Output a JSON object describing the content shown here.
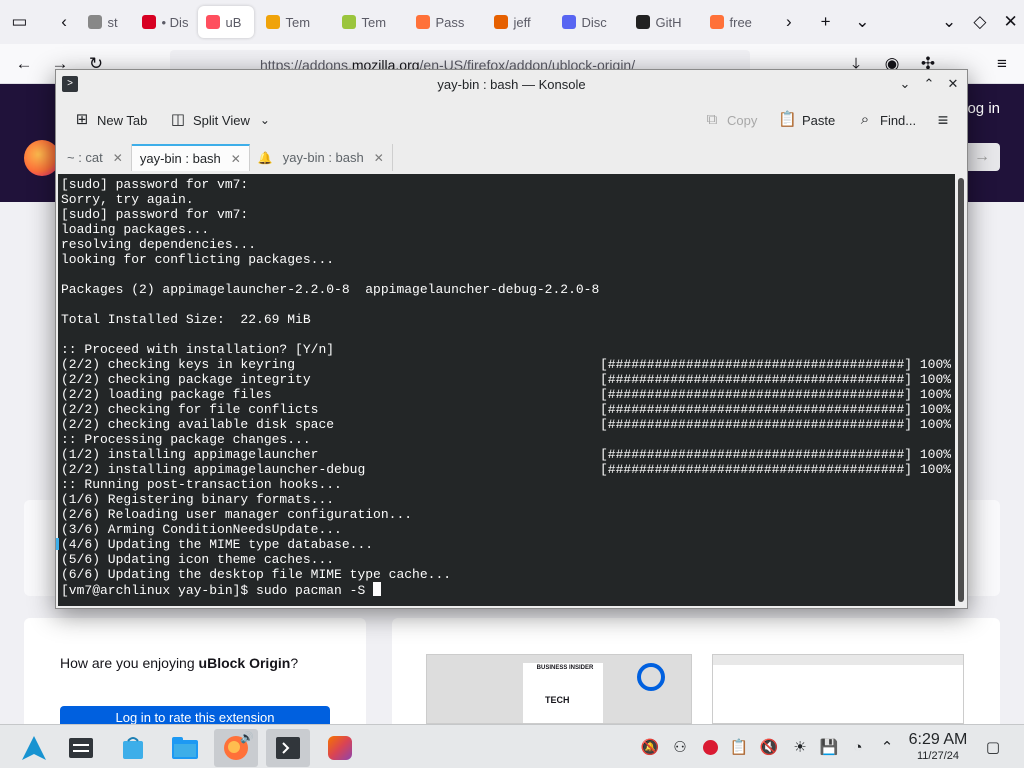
{
  "firefox": {
    "tabs": [
      {
        "label": "st",
        "color": "#888888"
      },
      {
        "label": "• Dis",
        "color": "#d70022"
      },
      {
        "label": "uB",
        "color": "#ff4f5e",
        "active": true
      },
      {
        "label": "Tem",
        "color": "#f0a30a"
      },
      {
        "label": "Tem",
        "color": "#9bc53d"
      },
      {
        "label": "Pass",
        "color": "#ff7139"
      },
      {
        "label": "jeff",
        "color": "#e66000"
      },
      {
        "label": "Disc",
        "color": "#5865f2"
      },
      {
        "label": "GitH",
        "color": "#222222"
      },
      {
        "label": "free",
        "color": "#ff7139"
      }
    ],
    "url_prefix": "https://addons.",
    "url_domain": "mozilla.org",
    "url_rest": "/en-US/firefox/addon/ublock-origin/",
    "login": "og in",
    "rate_question": "How are you enjoying ",
    "rate_addon": "uBlock Origin",
    "rate_suffix": "?",
    "login_button": "Log in to rate this extension",
    "shot_tag": "TECH",
    "shot_brand": "BUSINESS INSIDER"
  },
  "konsole": {
    "title": "yay-bin : bash — Konsole",
    "toolbar": {
      "new_tab": "New Tab",
      "split_view": "Split View",
      "copy": "Copy",
      "paste": "Paste",
      "find": "Find..."
    },
    "tabs": [
      {
        "label": "~ : cat",
        "active": false
      },
      {
        "label": "yay-bin : bash",
        "active": true
      },
      {
        "label": "yay-bin : bash",
        "active": false,
        "bell": true
      }
    ],
    "lines": [
      {
        "text": "[sudo] password for vm7:"
      },
      {
        "text": "Sorry, try again."
      },
      {
        "text": "[sudo] password for vm7:"
      },
      {
        "text": "loading packages..."
      },
      {
        "text": "resolving dependencies..."
      },
      {
        "text": "looking for conflicting packages..."
      },
      {
        "text": ""
      },
      {
        "text": "Packages (2) appimagelauncher-2.2.0-8  appimagelauncher-debug-2.2.0-8"
      },
      {
        "text": ""
      },
      {
        "text": "Total Installed Size:  22.69 MiB"
      },
      {
        "text": ""
      },
      {
        "text": ":: Proceed with installation? [Y/n]"
      },
      {
        "text": "(2/2) checking keys in keyring",
        "bar": "[######################################] 100%"
      },
      {
        "text": "(2/2) checking package integrity",
        "bar": "[######################################] 100%"
      },
      {
        "text": "(2/2) loading package files",
        "bar": "[######################################] 100%"
      },
      {
        "text": "(2/2) checking for file conflicts",
        "bar": "[######################################] 100%"
      },
      {
        "text": "(2/2) checking available disk space",
        "bar": "[######################################] 100%"
      },
      {
        "text": ":: Processing package changes..."
      },
      {
        "text": "(1/2) installing appimagelauncher",
        "bar": "[######################################] 100%"
      },
      {
        "text": "(2/2) installing appimagelauncher-debug",
        "bar": "[######################################] 100%"
      },
      {
        "text": ":: Running post-transaction hooks..."
      },
      {
        "text": "(1/6) Registering binary formats..."
      },
      {
        "text": "(2/6) Reloading user manager configuration..."
      },
      {
        "text": "(3/6) Arming ConditionNeedsUpdate..."
      },
      {
        "text": "(4/6) Updating the MIME type database..."
      },
      {
        "text": "(5/6) Updating icon theme caches..."
      },
      {
        "text": "(6/6) Updating the desktop file MIME type cache..."
      }
    ],
    "prompt": "[vm7@archlinux yay-bin]$ ",
    "command": "sudo pacman -S "
  },
  "taskbar": {
    "time": "6:29 AM",
    "date": "11/27/24"
  }
}
